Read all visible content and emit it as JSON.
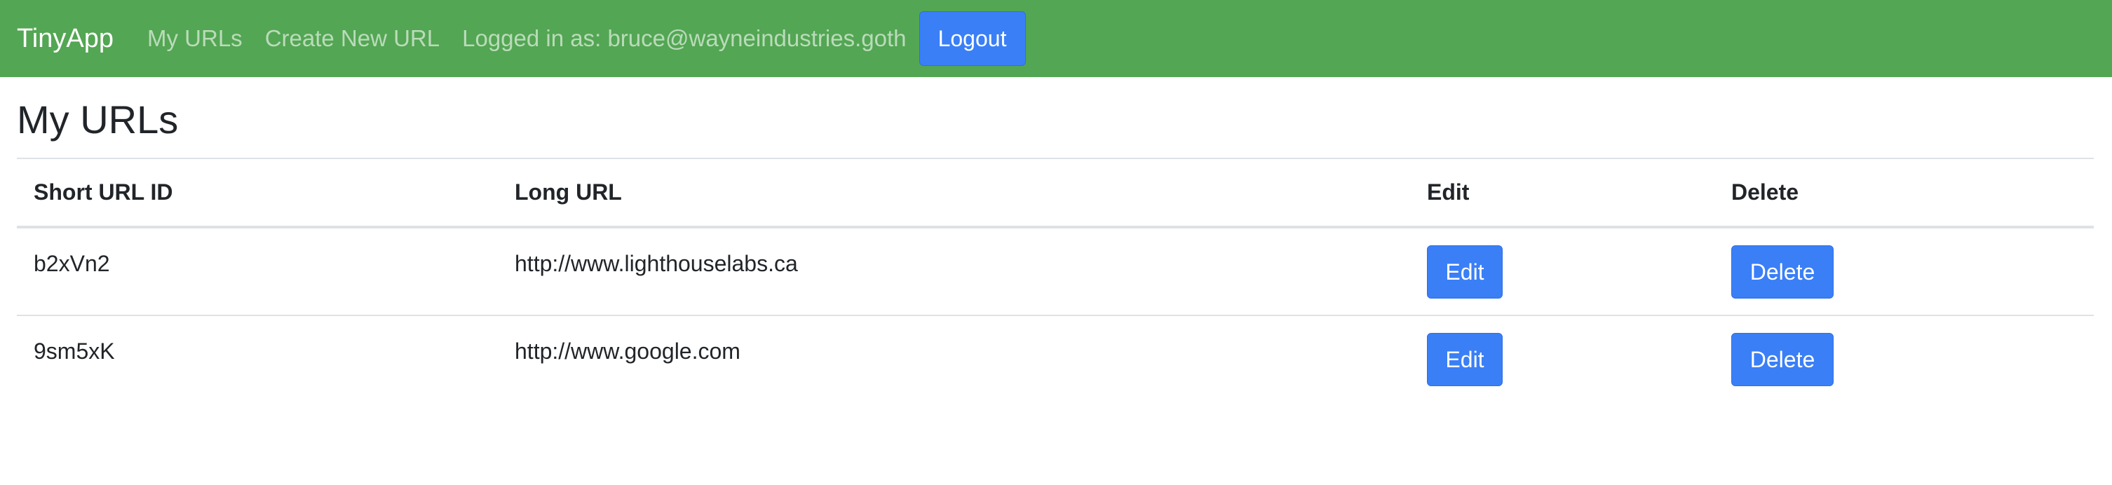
{
  "navbar": {
    "brand": "TinyApp",
    "links": {
      "my_urls": "My URLs",
      "create_new_url": "Create New URL"
    },
    "logged_in_text": "Logged in as: bruce@wayneindustries.goth",
    "logout_label": "Logout",
    "bg_color": "#53a653"
  },
  "main": {
    "title": "My URLs",
    "table": {
      "headers": {
        "short_url_id": "Short URL ID",
        "long_url": "Long URL",
        "edit": "Edit",
        "delete": "Delete"
      },
      "rows": [
        {
          "short_url_id": "b2xVn2",
          "long_url": "http://www.lighthouselabs.ca",
          "edit_label": "Edit",
          "delete_label": "Delete"
        },
        {
          "short_url_id": "9sm5xK",
          "long_url": "http://www.google.com",
          "edit_label": "Edit",
          "delete_label": "Delete"
        }
      ]
    }
  },
  "colors": {
    "button_blue": "#3a7ff6",
    "border_gray": "#dee2e6"
  }
}
